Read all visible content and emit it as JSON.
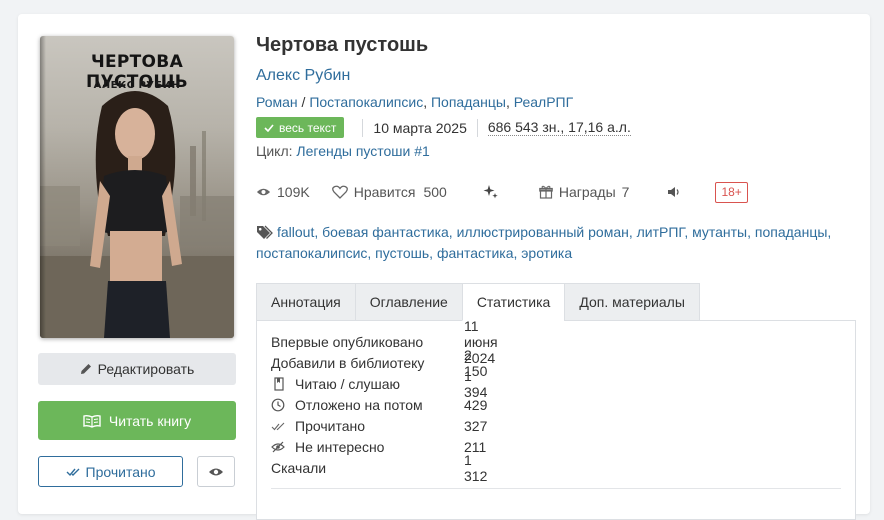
{
  "cover": {
    "title": "ЧЕРТОВА ПУСТОШЬ",
    "author": "АЛЕКС РУБИН"
  },
  "buttons": {
    "edit": "Редактировать",
    "read": "Читать книгу",
    "done": "Прочитано"
  },
  "book": {
    "title": "Чертова пустошь",
    "author": "Алекс Рубин",
    "genres": [
      "Роман",
      "Постапокалипсис",
      "Попаданцы",
      "РеалРПГ"
    ],
    "genre_sep1": " / ",
    "genre_sep2": ", ",
    "genre_sep3": ", ",
    "full_text_badge": "весь текст",
    "date": "10 марта 2025",
    "size": "686 543 зн., 17,16 а.л.",
    "cycle_label": "Цикл: ",
    "cycle_name": "Легенды пустоши #1"
  },
  "stats": {
    "views": "109K",
    "likes_label": "Нравится",
    "likes": "500",
    "awards_label": "Награды",
    "awards": "7",
    "age": "18+"
  },
  "tags": [
    "fallout",
    "боевая фантастика",
    "иллюстрированный роман",
    "литРПГ",
    "мутанты",
    "попаданцы",
    "постапокалипсис",
    "пустошь",
    "фантастика",
    "эротика"
  ],
  "tabs": [
    "Аннотация",
    "Оглавление",
    "Статистика",
    "Доп. материалы"
  ],
  "statistics": [
    {
      "label": "Впервые опубликовано",
      "value": "11 июня 2024",
      "icon": ""
    },
    {
      "label": "Добавили в библиотеку",
      "value": "2 150",
      "icon": ""
    },
    {
      "label": "Читаю / слушаю",
      "value": "1 394",
      "icon": "bookmark-icon"
    },
    {
      "label": "Отложено на потом",
      "value": "429",
      "icon": "clock-icon"
    },
    {
      "label": "Прочитано",
      "value": "327",
      "icon": "double-check-icon"
    },
    {
      "label": "Не интересно",
      "value": "211",
      "icon": "eye-off-icon"
    },
    {
      "label": "Скачали",
      "value": "1 312",
      "icon": ""
    }
  ],
  "colors": {
    "link": "#2f6d9c",
    "green": "#6cb75a",
    "age_red": "#d9534f"
  }
}
